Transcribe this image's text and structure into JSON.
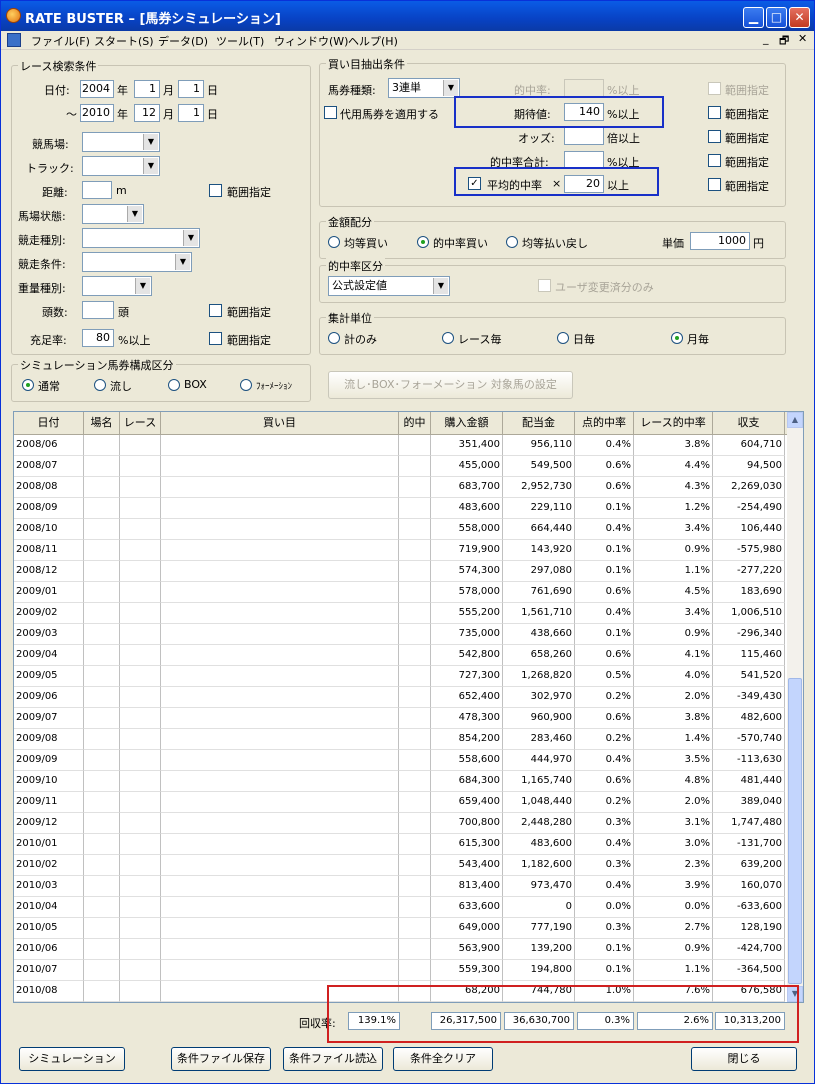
{
  "window": {
    "title": "RATE BUSTER – [馬券シミュレーション]"
  },
  "menu": [
    "ファイル(F)",
    "スタート(S)",
    "データ(D)",
    "ツール(T)",
    "ウィンドウ(W)",
    "ヘルプ(H)"
  ],
  "race_search": {
    "title": "レース検索条件",
    "date_label": "日付:",
    "from_year": "2004",
    "from_month": "1",
    "from_day": "1",
    "to_prefix": "～",
    "to_year": "2010",
    "to_month": "12",
    "to_day": "1",
    "year_unit": "年",
    "month_unit": "月",
    "day_unit": "日",
    "racecourse_label": "競馬場:",
    "track_label": "トラック:",
    "distance_label": "距離:",
    "distance_unit": "m",
    "range_label": "範囲指定",
    "condition_label": "馬場状態:",
    "race_type_label": "競走種別:",
    "race_cond_label": "競走条件:",
    "weight_label": "重量種別:",
    "heads_label": "頭数:",
    "heads_unit": "頭",
    "fill_label": "充足率:",
    "fill_value": "80",
    "fill_unit": "%以上"
  },
  "buy_extract": {
    "title": "買い目抽出条件",
    "ticket_type_label": "馬券種類:",
    "ticket_type_value": "3連単",
    "substitute_label": "代用馬券を適用する",
    "hit_rate_label": "的中率:",
    "hit_rate_unit": "%以上",
    "expected_label": "期待値:",
    "expected_value": "140",
    "expected_unit": "%以上",
    "odds_label": "オッズ:",
    "odds_unit": "倍以上",
    "hit_total_label": "的中率合計:",
    "hit_total_unit": "%以上",
    "avg_hit_label": "平均的中率",
    "avg_hit_mult": "×",
    "avg_hit_value": "20",
    "avg_hit_unit": "以上",
    "range_label": "範囲指定"
  },
  "amount_alloc": {
    "title": "金額配分",
    "opt1": "均等買い",
    "opt2": "的中率買い",
    "opt3": "均等払い戻し",
    "unit_price_label": "単価",
    "unit_price_value": "1000",
    "unit_price_unit": "円"
  },
  "hit_class": {
    "title": "的中率区分",
    "value": "公式設定値",
    "user_only_label": "ユーザ変更済分のみ"
  },
  "agg_unit": {
    "title": "集計単位",
    "opt1": "計のみ",
    "opt2": "レース毎",
    "opt3": "日毎",
    "opt4": "月毎"
  },
  "sim_type": {
    "title": "シミュレーション馬券構成区分",
    "opt1": "通常",
    "opt2": "流し",
    "opt3": "BOX",
    "opt4": "ﾌｫｰﾒｰｼｮﾝ"
  },
  "formation_button": "流し･BOX･フォーメーション 対象馬の設定",
  "table": {
    "headers": [
      "日付",
      "場名",
      "レース",
      "買い目",
      "的中",
      "購入金額",
      "配当金",
      "点的中率",
      "レース的中率",
      "収支"
    ],
    "rows": [
      [
        "2008/06",
        "",
        "",
        "",
        "",
        "351,400",
        "956,110",
        "0.4%",
        "3.8%",
        "604,710"
      ],
      [
        "2008/07",
        "",
        "",
        "",
        "",
        "455,000",
        "549,500",
        "0.6%",
        "4.4%",
        "94,500"
      ],
      [
        "2008/08",
        "",
        "",
        "",
        "",
        "683,700",
        "2,952,730",
        "0.6%",
        "4.3%",
        "2,269,030"
      ],
      [
        "2008/09",
        "",
        "",
        "",
        "",
        "483,600",
        "229,110",
        "0.1%",
        "1.2%",
        "-254,490"
      ],
      [
        "2008/10",
        "",
        "",
        "",
        "",
        "558,000",
        "664,440",
        "0.4%",
        "3.4%",
        "106,440"
      ],
      [
        "2008/11",
        "",
        "",
        "",
        "",
        "719,900",
        "143,920",
        "0.1%",
        "0.9%",
        "-575,980"
      ],
      [
        "2008/12",
        "",
        "",
        "",
        "",
        "574,300",
        "297,080",
        "0.1%",
        "1.1%",
        "-277,220"
      ],
      [
        "2009/01",
        "",
        "",
        "",
        "",
        "578,000",
        "761,690",
        "0.6%",
        "4.5%",
        "183,690"
      ],
      [
        "2009/02",
        "",
        "",
        "",
        "",
        "555,200",
        "1,561,710",
        "0.4%",
        "3.4%",
        "1,006,510"
      ],
      [
        "2009/03",
        "",
        "",
        "",
        "",
        "735,000",
        "438,660",
        "0.1%",
        "0.9%",
        "-296,340"
      ],
      [
        "2009/04",
        "",
        "",
        "",
        "",
        "542,800",
        "658,260",
        "0.6%",
        "4.1%",
        "115,460"
      ],
      [
        "2009/05",
        "",
        "",
        "",
        "",
        "727,300",
        "1,268,820",
        "0.5%",
        "4.0%",
        "541,520"
      ],
      [
        "2009/06",
        "",
        "",
        "",
        "",
        "652,400",
        "302,970",
        "0.2%",
        "2.0%",
        "-349,430"
      ],
      [
        "2009/07",
        "",
        "",
        "",
        "",
        "478,300",
        "960,900",
        "0.6%",
        "3.8%",
        "482,600"
      ],
      [
        "2009/08",
        "",
        "",
        "",
        "",
        "854,200",
        "283,460",
        "0.2%",
        "1.4%",
        "-570,740"
      ],
      [
        "2009/09",
        "",
        "",
        "",
        "",
        "558,600",
        "444,970",
        "0.4%",
        "3.5%",
        "-113,630"
      ],
      [
        "2009/10",
        "",
        "",
        "",
        "",
        "684,300",
        "1,165,740",
        "0.6%",
        "4.8%",
        "481,440"
      ],
      [
        "2009/11",
        "",
        "",
        "",
        "",
        "659,400",
        "1,048,440",
        "0.2%",
        "2.0%",
        "389,040"
      ],
      [
        "2009/12",
        "",
        "",
        "",
        "",
        "700,800",
        "2,448,280",
        "0.3%",
        "3.1%",
        "1,747,480"
      ],
      [
        "2010/01",
        "",
        "",
        "",
        "",
        "615,300",
        "483,600",
        "0.4%",
        "3.0%",
        "-131,700"
      ],
      [
        "2010/02",
        "",
        "",
        "",
        "",
        "543,400",
        "1,182,600",
        "0.3%",
        "2.3%",
        "639,200"
      ],
      [
        "2010/03",
        "",
        "",
        "",
        "",
        "813,400",
        "973,470",
        "0.4%",
        "3.9%",
        "160,070"
      ],
      [
        "2010/04",
        "",
        "",
        "",
        "",
        "633,600",
        "0",
        "0.0%",
        "0.0%",
        "-633,600"
      ],
      [
        "2010/05",
        "",
        "",
        "",
        "",
        "649,000",
        "777,190",
        "0.3%",
        "2.7%",
        "128,190"
      ],
      [
        "2010/06",
        "",
        "",
        "",
        "",
        "563,900",
        "139,200",
        "0.1%",
        "0.9%",
        "-424,700"
      ],
      [
        "2010/07",
        "",
        "",
        "",
        "",
        "559,300",
        "194,800",
        "0.1%",
        "1.1%",
        "-364,500"
      ],
      [
        "2010/08",
        "",
        "",
        "",
        "",
        "68,200",
        "744,780",
        "1.0%",
        "7.6%",
        "676,580"
      ]
    ]
  },
  "summary": {
    "recovery_label": "回収率:",
    "recovery_value": "139.1%",
    "purchase_total": "26,317,500",
    "payout_total": "36,630,700",
    "point_hit": "0.3%",
    "race_hit": "2.6%",
    "balance_total": "10,313,200"
  },
  "buttons": {
    "simulate": "シミュレーション",
    "save": "条件ファイル保存",
    "load": "条件ファイル読込",
    "clear": "条件全クリア",
    "close": "閉じる"
  }
}
